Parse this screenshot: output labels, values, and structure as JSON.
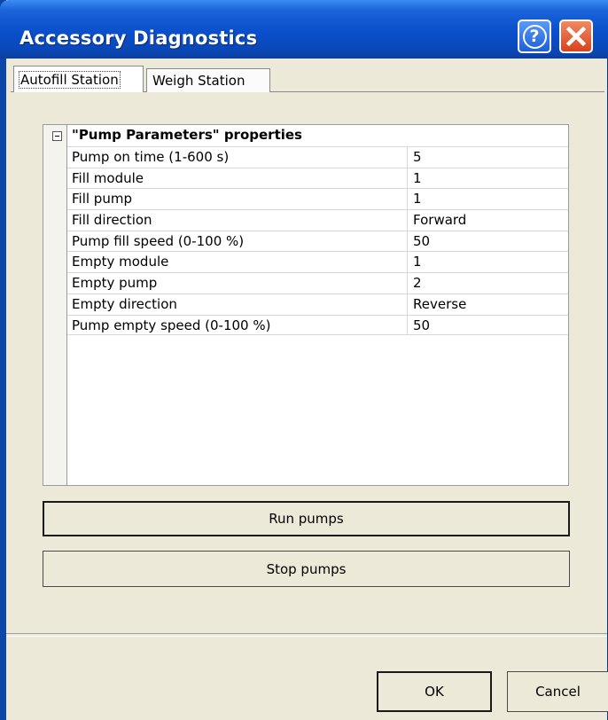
{
  "window": {
    "title": "Accessory Diagnostics",
    "help_icon": "help-icon",
    "close_icon": "close-icon",
    "help_glyph": "?"
  },
  "tabs": [
    {
      "label": "Autofill Station",
      "active": true
    },
    {
      "label": "Weigh Station",
      "active": false
    }
  ],
  "property_grid": {
    "category": "\"Pump Parameters\" properties",
    "collapse_icon": "collapse-icon",
    "rows": [
      {
        "name": "Pump on time (1-600 s)",
        "value": "5"
      },
      {
        "name": "Fill module",
        "value": "1"
      },
      {
        "name": "Fill pump",
        "value": "1"
      },
      {
        "name": "Fill direction",
        "value": "Forward"
      },
      {
        "name": "Pump fill speed (0-100 %)",
        "value": "50"
      },
      {
        "name": "Empty module",
        "value": "1"
      },
      {
        "name": "Empty pump",
        "value": "2"
      },
      {
        "name": "Empty direction",
        "value": "Reverse"
      },
      {
        "name": "Pump empty speed (0-100 %)",
        "value": "50"
      }
    ]
  },
  "actions": {
    "run_label": "Run pumps",
    "stop_label": "Stop pumps"
  },
  "footer": {
    "ok_label": "OK",
    "cancel_label": "Cancel"
  },
  "colors": {
    "titlebar": "#0a4fcb",
    "close_button": "#d8421e",
    "dialog_background": "#ece9d8"
  }
}
